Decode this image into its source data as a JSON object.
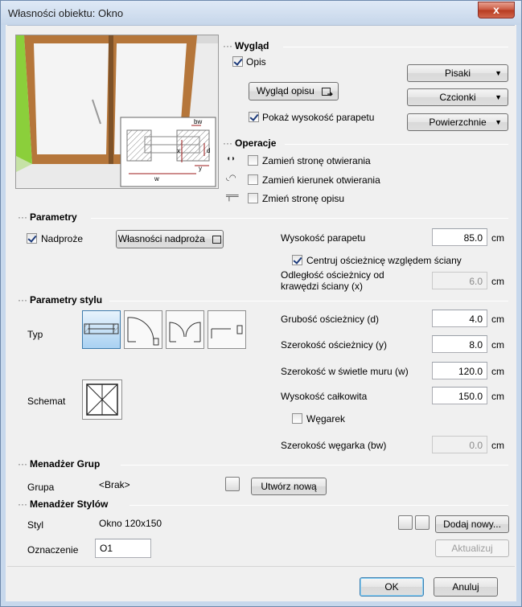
{
  "window": {
    "title": "Własności obiektu: Okno",
    "close_glyph": "x"
  },
  "appearance": {
    "heading": "Wygląd",
    "opis_label": "Opis",
    "opis_checked": true,
    "wyglad_opisu_button": "Wygląd opisu",
    "show_sill_label": "Pokaż wysokość parapetu",
    "show_sill_checked": true,
    "pisaki_button": "Pisaki",
    "czcionki_button": "Czcionki",
    "powierzchnie_button": "Powierzchnie"
  },
  "diagram": {
    "bw": "bw",
    "x": "x",
    "d": "d",
    "y": "y",
    "w": "w"
  },
  "operations": {
    "heading": "Operacje",
    "items": [
      {
        "label": "Zamień stronę otwierania",
        "checked": false,
        "icon": "swap-side-icon"
      },
      {
        "label": "Zamień kierunek otwierania",
        "checked": false,
        "icon": "swap-direction-icon"
      },
      {
        "label": "Zmień stronę opisu",
        "checked": false,
        "icon": "description-side-icon"
      }
    ]
  },
  "parameters": {
    "heading": "Parametry",
    "lintel_label": "Nadproże",
    "lintel_checked": true,
    "lintel_props_button": "Własności nadproża",
    "sill_height_label": "Wysokość parapetu",
    "sill_height_value": "85.0",
    "sill_height_unit": "cm",
    "center_label": "Centruj ościeżnicę względem ściany",
    "center_checked": true,
    "offset_label_line1": "Odległość ościeżnicy od",
    "offset_label_line2": "krawędzi ściany (x)",
    "offset_value": "6.0",
    "offset_unit": "cm"
  },
  "style_parameters": {
    "heading": "Parametry stylu",
    "type_label": "Typ",
    "scheme_label": "Schemat",
    "frame_thickness_label": "Grubość ościeżnicy (d)",
    "frame_thickness_value": "4.0",
    "frame_width_label": "Szerokość ościeżnicy (y)",
    "frame_width_value": "8.0",
    "clear_width_label": "Szerokość w świetle muru (w)",
    "clear_width_value": "120.0",
    "total_height_label": "Wysokość całkowita",
    "total_height_value": "150.0",
    "wegarek_label": "Węgarek",
    "wegarek_checked": false,
    "wegarek_width_label": "Szerokość węgarka (bw)",
    "wegarek_width_value": "0.0",
    "unit": "cm"
  },
  "group_manager": {
    "heading": "Menadżer Grup",
    "group_label": "Grupa",
    "group_value": "<Brak>",
    "create_button": "Utwórz nową"
  },
  "style_manager": {
    "heading": "Menadżer Stylów",
    "style_label": "Styl",
    "style_value": "Okno 120x150",
    "add_button": "Dodaj nowy...",
    "mark_label": "Oznaczenie",
    "mark_value": "O1",
    "update_button": "Aktualizuj"
  },
  "footer": {
    "ok_button": "OK",
    "cancel_button": "Anuluj"
  },
  "colors": {
    "accent": "#3c7fb1",
    "title_bar": "#c6d6ea",
    "close": "#c8553d",
    "frame_wood": "#b5763a"
  }
}
